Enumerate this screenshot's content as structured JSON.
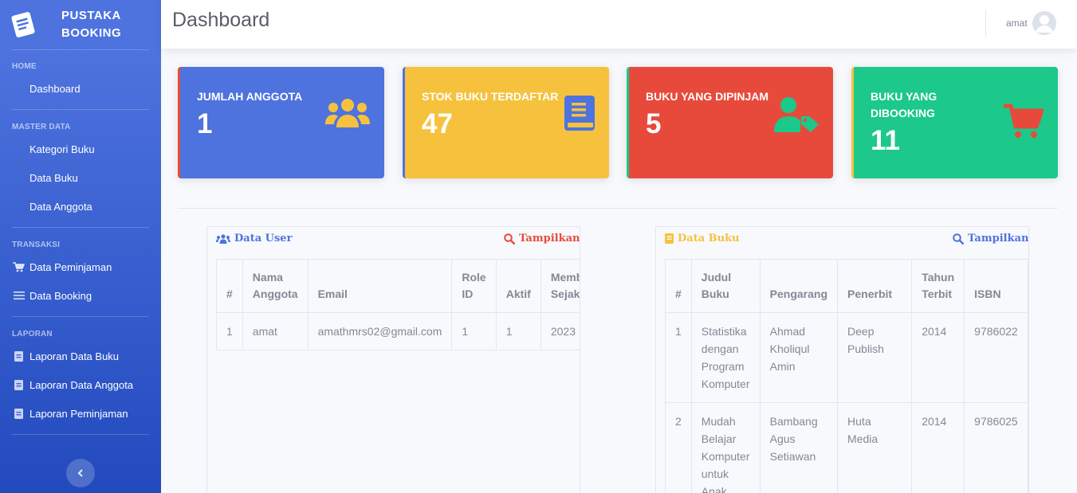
{
  "brand": {
    "line1": "PUSTAKA",
    "line2": "BOOKING"
  },
  "sidebar": {
    "sections": [
      {
        "heading": "HOME",
        "items": [
          {
            "label": "Dashboard",
            "icon": "none"
          }
        ]
      },
      {
        "heading": "MASTER DATA",
        "items": [
          {
            "label": "Kategori Buku",
            "icon": "none"
          },
          {
            "label": "Data Buku",
            "icon": "none"
          },
          {
            "label": "Data Anggota",
            "icon": "none"
          }
        ]
      },
      {
        "heading": "TRANSAKSI",
        "items": [
          {
            "label": "Data Peminjaman",
            "icon": "cart-icon"
          },
          {
            "label": "Data Booking",
            "icon": "list-icon"
          }
        ]
      },
      {
        "heading": "LAPORAN",
        "items": [
          {
            "label": "Laporan Data Buku",
            "icon": "book-icon"
          },
          {
            "label": "Laporan Data Anggota",
            "icon": "book-icon"
          },
          {
            "label": "Laporan Peminjaman",
            "icon": "book-icon"
          }
        ]
      }
    ],
    "toggle_icon": "chevron-left-icon"
  },
  "topbar": {
    "title": "Dashboard",
    "user_name": "amat"
  },
  "cards": [
    {
      "label": "JUMLAH ANGGOTA",
      "value": "1",
      "color": "#4e73df",
      "border": "#e74a3b",
      "icon": "users-icon"
    },
    {
      "label": "STOK BUKU TERDAFTAR",
      "value": "47",
      "color": "#f6c23e",
      "border": "#4e73df",
      "icon": "book-icon"
    },
    {
      "label": "BUKU YANG DIPINJAM",
      "value": "5",
      "color": "#e74a3b",
      "border": "#1cc88a",
      "icon": "user-tag-icon"
    },
    {
      "label": "BUKU YANG DIBOOKING",
      "value": "11",
      "color": "#1cc88a",
      "border": "#f6c23e",
      "icon": "cart-icon"
    }
  ],
  "user_panel": {
    "title": "Data User",
    "button": "Tampilkan",
    "columns": [
      "#",
      "Nama Anggota",
      "Email",
      "Role ID",
      "Aktif",
      "Member Sejak"
    ],
    "rows": [
      [
        "1",
        "amat",
        "amathmrs02@gmail.com",
        "1",
        "1",
        "2023"
      ]
    ]
  },
  "book_panel": {
    "title": "Data Buku",
    "button": "Tampilkan",
    "columns": [
      "#",
      "Judul Buku",
      "Pengarang",
      "Penerbit",
      "Tahun Terbit",
      "ISBN"
    ],
    "rows": [
      [
        "1",
        "Statistika dengan Program Komputer",
        "Ahmad Kholiqul Amin",
        "Deep Publish",
        "2014",
        "9786022"
      ],
      [
        "2",
        "Mudah Belajar Komputer untuk Anak",
        "Bambang Agus Setiawan",
        "Huta Media",
        "2014",
        "9786025"
      ]
    ]
  },
  "colors": {
    "primary": "#4e73df",
    "warning": "#f6c23e",
    "danger": "#e74a3b",
    "success": "#1cc88a"
  }
}
